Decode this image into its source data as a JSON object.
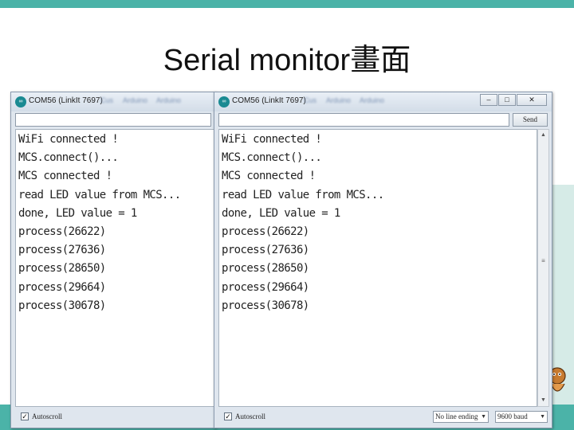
{
  "slide": {
    "title": "Serial monitor畫面"
  },
  "windows": [
    {
      "title": "COM56 (LinkIt 7697)",
      "icon_label": "∞",
      "blurred_menu": [
        "Cus",
        "Arduino",
        "Arduino"
      ],
      "output_lines": [
        "WiFi connected !",
        "MCS.connect()...",
        "MCS connected !",
        "read LED value from MCS...",
        "done, LED value = 1",
        "process(26622)",
        "process(27636)",
        "process(28650)",
        "process(29664)",
        "process(30678)"
      ],
      "autoscroll_label": "Autoscroll"
    },
    {
      "title": "COM56 (LinkIt 7697)",
      "icon_label": "∞",
      "blurred_menu": [
        "Cus",
        "Arduino",
        "Arduino"
      ],
      "send_label": "Send",
      "output_lines": [
        "WiFi connected !",
        "MCS.connect()...",
        "MCS connected !",
        "read LED value from MCS...",
        "done, LED value = 1",
        "process(26622)",
        "process(27636)",
        "process(28650)",
        "process(29664)",
        "process(30678)"
      ],
      "autoscroll_label": "Autoscroll",
      "line_ending": "No line ending",
      "baud": "9600 baud"
    }
  ],
  "icons": {
    "minimize": "minimize-icon",
    "maximize": "maximize-icon",
    "close": "close-icon",
    "check": "checkmark-icon"
  },
  "colors": {
    "accent_bar": "#4bb3a8",
    "window_chrome": "#dfe6ee"
  }
}
